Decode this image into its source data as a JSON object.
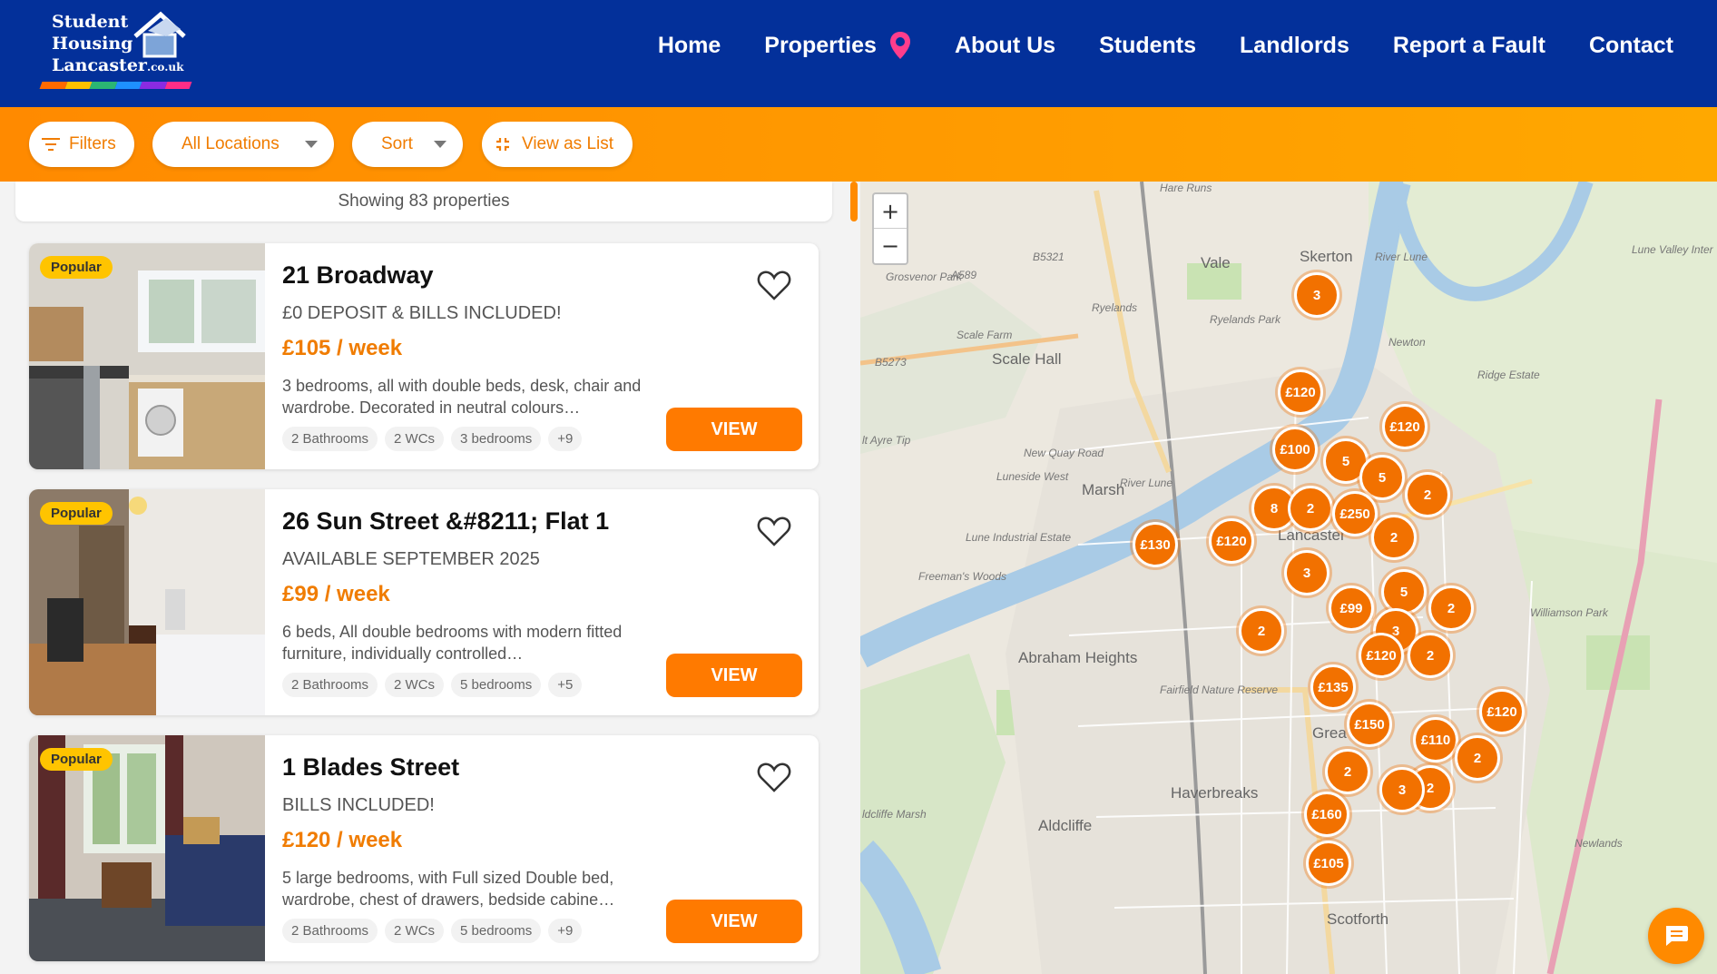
{
  "logo": {
    "line1": "Student",
    "line2": "Housing",
    "line3": "Lancaster",
    "domain": ".co.uk",
    "stripe_colors": [
      "#ff6a00",
      "#ffc000",
      "#2bb673",
      "#1e90ff",
      "#8a2be2",
      "#ff2d87"
    ]
  },
  "nav": {
    "items": [
      "Home",
      "Properties",
      "About Us",
      "Students",
      "Landlords",
      "Report a Fault",
      "Contact"
    ]
  },
  "filters": {
    "filters_label": "Filters",
    "location_label": "All Locations",
    "sort_label": "Sort",
    "view_list_label": "View as List"
  },
  "list": {
    "showing": "Showing 83 properties",
    "view_label": "VIEW",
    "badge": "Popular",
    "properties": [
      {
        "title": "21 Broadway",
        "subtitle": "£0 DEPOSIT & BILLS INCLUDED!",
        "price": "£105 / week",
        "description": "3 bedrooms, all with double beds, desk, chair and wardrobe. Decorated in neutral colours…",
        "tags": [
          "2 Bathrooms",
          "2 WCs",
          "3 bedrooms",
          "+9"
        ]
      },
      {
        "title": "26 Sun Street &#8211; Flat 1",
        "subtitle": "AVAILABLE SEPTEMBER 2025",
        "price": "£99 / week",
        "description": "6 beds, All double bedrooms with modern fitted furniture, individually controlled…",
        "tags": [
          "2 Bathrooms",
          "2 WCs",
          "5 bedrooms",
          "+5"
        ]
      },
      {
        "title": "1 Blades Street",
        "subtitle": "BILLS INCLUDED!",
        "price": "£120 / week",
        "description": "5 large bedrooms, with Full sized Double bed, wardrobe, chest of drawers, bedside cabine…",
        "tags": [
          "2 Bathrooms",
          "2 WCs",
          "5 bedrooms",
          "+9"
        ]
      }
    ]
  },
  "map": {
    "zoom_in": "+",
    "zoom_out": "−",
    "labels": {
      "vale": "Vale",
      "skerton": "Skerton",
      "scale_hall": "Scale Hall",
      "marsh": "Marsh",
      "lancaster": "Lancaster",
      "abraham_heights": "Abraham Heights",
      "haverbreaks": "Haverbreaks",
      "aldcliffe": "Aldcliffe",
      "scotforth": "Scotforth",
      "greaves": "Grea",
      "river_lune": "River Lune",
      "ryelands_park": "Ryelands Park",
      "williamson_park": "Williamson Park",
      "lune_valley": "Lune Valley Inter",
      "b5321": "B5321",
      "a589": "A589",
      "b5273": "B5273",
      "luneside_west": "Luneside West",
      "lune_industrial": "Lune Industrial Estate",
      "freemans_woods": "Freeman's Woods",
      "fairfield": "Fairfield Nature Reserve",
      "newlands": "Newlands",
      "newton": "Newton",
      "ridge_estate": "Ridge Estate",
      "grosvenor_park": "Grosvenor Park",
      "new_quay_road": "New Quay Road",
      "hare_runs": "Hare Runs",
      "scale_farm": "Scale Farm",
      "ryelands": "Ryelands",
      "aldcliffe_marsh": "ldcliffe Marsh",
      "alt_ayre": "lt Ayre Tip"
    },
    "markers": [
      "3",
      "£120",
      "£120",
      "£100",
      "5",
      "5",
      "2",
      "8",
      "2",
      "£250",
      "£130",
      "£120",
      "2",
      "3",
      "5",
      "£99",
      "2",
      "2",
      "3",
      "£120",
      "2",
      "£135",
      "£120",
      "£150",
      "£110",
      "2",
      "2",
      "2",
      "3",
      "£160",
      "£105",
      "2"
    ]
  },
  "chat": {
    "icon": "chat-icon"
  }
}
